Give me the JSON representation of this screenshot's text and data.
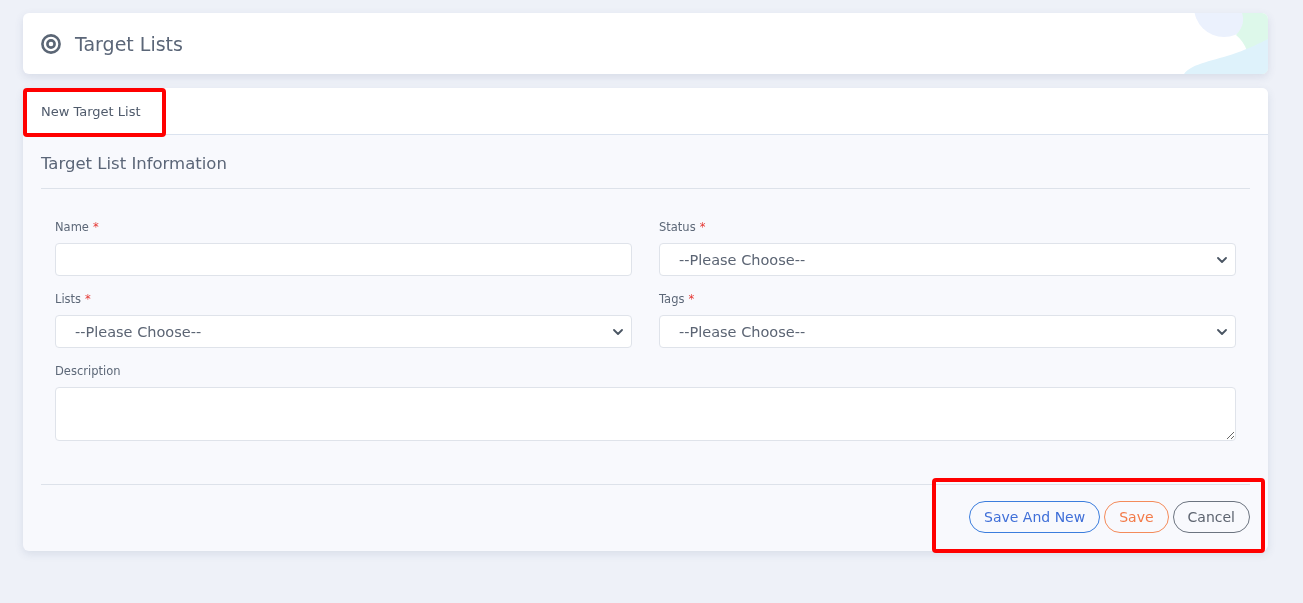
{
  "page_header": {
    "title": "Target Lists"
  },
  "tabs": [
    {
      "label": "New Target List",
      "selected": true,
      "highlighted": true
    }
  ],
  "section": {
    "title": "Target List Information"
  },
  "fields": [
    {
      "kind": "text",
      "label": "Name",
      "required_mark": "*"
    },
    {
      "kind": "select",
      "label": "Status",
      "required_mark": "*",
      "value": "--Please Choose--"
    },
    {
      "kind": "select",
      "label": "Lists",
      "required_mark": "*",
      "value": "--Please Choose--"
    },
    {
      "kind": "select",
      "label": "Tags",
      "required_mark": "*",
      "value": "--Please Choose--"
    },
    {
      "kind": "textarea",
      "label": "Description"
    }
  ],
  "actions": {
    "highlighted": true,
    "buttons": [
      {
        "label": "Save And New",
        "kind": "primary"
      },
      {
        "label": "Save",
        "kind": "warning"
      },
      {
        "label": "Cancel",
        "kind": "secondary"
      }
    ]
  }
}
